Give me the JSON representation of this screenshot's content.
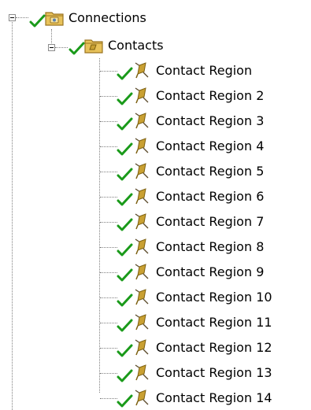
{
  "tree": {
    "root": {
      "label": "Connections",
      "icon": "connections-folder-icon",
      "status_icon": "green-check-icon",
      "expanded": true
    },
    "group": {
      "label": "Contacts",
      "icon": "contacts-folder-icon",
      "status_icon": "green-check-icon",
      "expanded": true
    },
    "items": [
      {
        "label": "Contact Region",
        "icon": "contact-flag-icon",
        "status_icon": "green-check-icon"
      },
      {
        "label": "Contact Region 2",
        "icon": "contact-flag-icon",
        "status_icon": "green-check-icon"
      },
      {
        "label": "Contact Region 3",
        "icon": "contact-flag-icon",
        "status_icon": "green-check-icon"
      },
      {
        "label": "Contact Region 4",
        "icon": "contact-flag-icon",
        "status_icon": "green-check-icon"
      },
      {
        "label": "Contact Region 5",
        "icon": "contact-flag-icon",
        "status_icon": "green-check-icon"
      },
      {
        "label": "Contact Region 6",
        "icon": "contact-flag-icon",
        "status_icon": "green-check-icon"
      },
      {
        "label": "Contact Region 7",
        "icon": "contact-flag-icon",
        "status_icon": "green-check-icon"
      },
      {
        "label": "Contact Region 8",
        "icon": "contact-flag-icon",
        "status_icon": "green-check-icon"
      },
      {
        "label": "Contact Region 9",
        "icon": "contact-flag-icon",
        "status_icon": "green-check-icon"
      },
      {
        "label": "Contact Region 10",
        "icon": "contact-flag-icon",
        "status_icon": "green-check-icon"
      },
      {
        "label": "Contact Region 11",
        "icon": "contact-flag-icon",
        "status_icon": "green-check-icon"
      },
      {
        "label": "Contact Region 12",
        "icon": "contact-flag-icon",
        "status_icon": "green-check-icon"
      },
      {
        "label": "Contact Region 13",
        "icon": "contact-flag-icon",
        "status_icon": "green-check-icon"
      },
      {
        "label": "Contact Region 14",
        "icon": "contact-flag-icon",
        "status_icon": "green-check-icon"
      }
    ]
  },
  "colors": {
    "check": "#1a9a1a",
    "folder_body": "#e8c25a",
    "folder_edge": "#9a7422",
    "flag": "#c9a032",
    "flag_edge": "#7d6010",
    "guide_line": "#808080"
  }
}
